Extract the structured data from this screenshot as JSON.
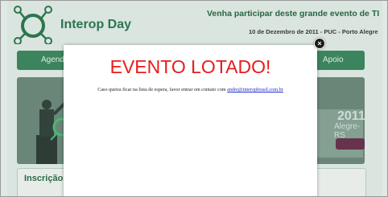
{
  "header": {
    "logo_text": "Interop Day",
    "slogan": "Venha participar deste grande evento de TI",
    "date": "10 de Dezembro de 2011 - PUC - Porto Alegre"
  },
  "nav": {
    "items": [
      {
        "label": "Agenda"
      },
      {
        "label": "Apoio"
      }
    ]
  },
  "banner": {
    "year": "2011",
    "place": "Alegre-RS"
  },
  "sidebar": {
    "inscricao_label": "Inscrição"
  },
  "modal": {
    "title": "EVENTO LOTADO!",
    "message": "Caso queira ficar na lista de espera, favor entrar em contato com",
    "email": "andre@interopbrasil.com.br",
    "close_label": "×"
  },
  "colors": {
    "accent": "#3f8a62",
    "title_red": "#ea1b1b",
    "link": "#1a2bcc"
  }
}
